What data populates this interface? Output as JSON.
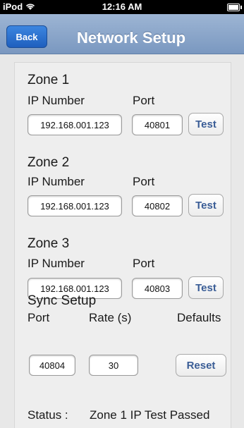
{
  "statusbar": {
    "device": "iPod",
    "time": "12:16 AM",
    "wifi_icon": "wifi-icon",
    "battery_icon": "battery-icon"
  },
  "navbar": {
    "back_label": "Back",
    "title": "Network Setup"
  },
  "zones": [
    {
      "title": "Zone 1",
      "ip_label": "IP Number",
      "port_label": "Port",
      "ip_value": "192.168.001.123",
      "port_value": "40801",
      "test_label": "Test"
    },
    {
      "title": "Zone 2",
      "ip_label": "IP Number",
      "port_label": "Port",
      "ip_value": "192.168.001.123",
      "port_value": "40802",
      "test_label": "Test"
    },
    {
      "title": "Zone 3",
      "ip_label": "IP Number",
      "port_label": "Port",
      "ip_value": "192.168.001.123",
      "port_value": "40803",
      "test_label": "Test"
    }
  ],
  "sync": {
    "title": "Sync Setup",
    "port_label": "Port",
    "rate_label": "Rate (s)",
    "defaults_label": "Defaults",
    "port_value": "40804",
    "rate_value": "30",
    "reset_label": "Reset"
  },
  "status": {
    "label": "Status :",
    "message": "Zone 1 IP Test Passed"
  }
}
